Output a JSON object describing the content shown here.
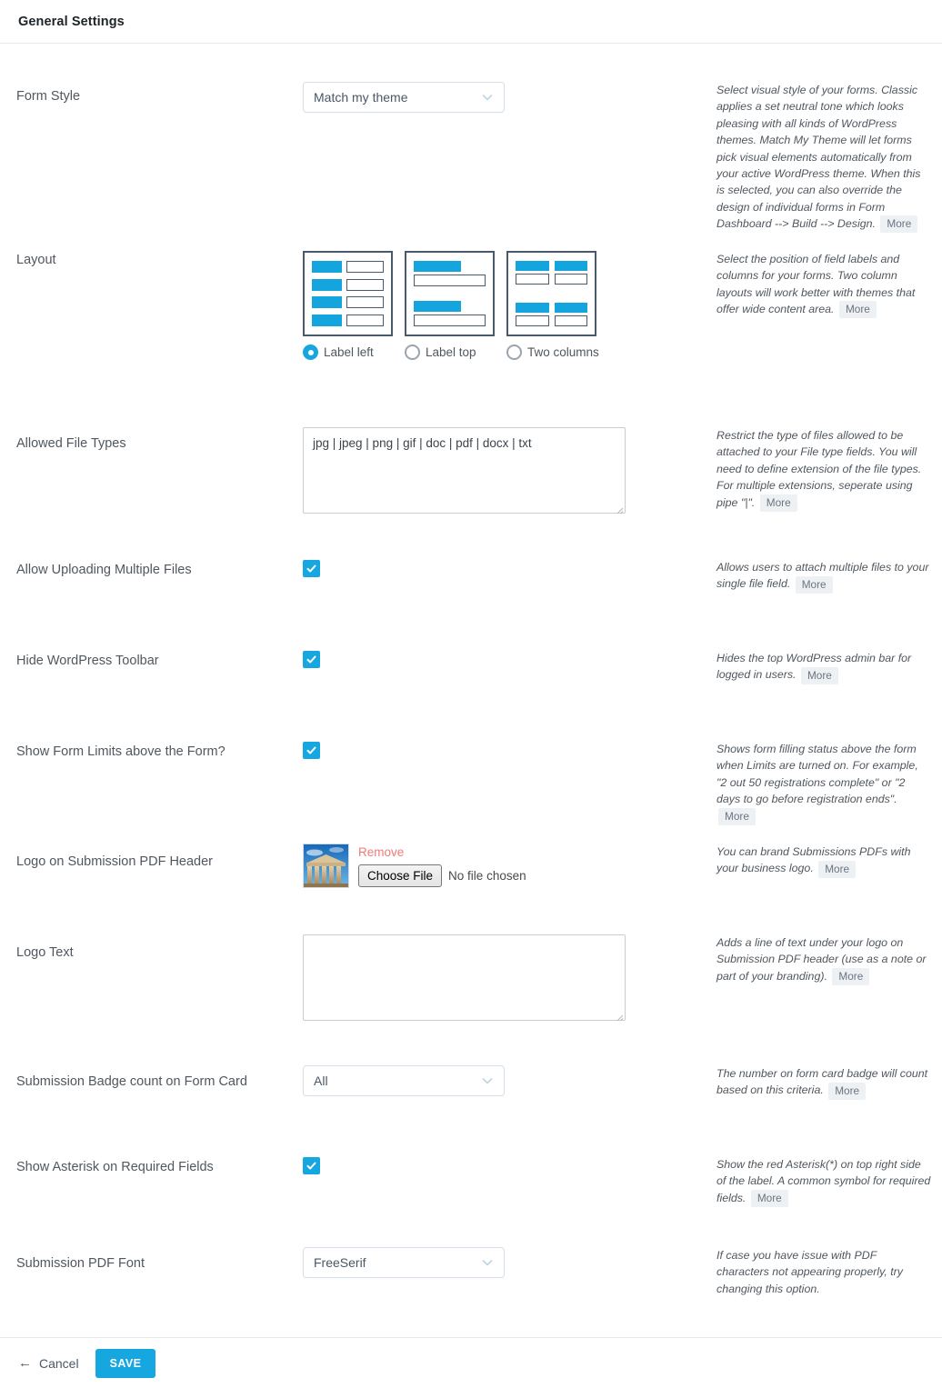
{
  "header": {
    "title": "General Settings"
  },
  "settings": {
    "form_style": {
      "label": "Form Style",
      "value": "Match my theme",
      "description": "Select visual style of your forms. Classic applies a set neutral tone which looks pleasing with all kinds of WordPress themes. Match My Theme will let forms pick visual elements automatically from your active WordPress theme. When this is selected, you can also override the design of individual forms in Form Dashboard --> Build --> Design.",
      "more_label": "More"
    },
    "layout": {
      "label": "Layout",
      "description": "Select the position of field labels and columns for your forms. Two column layouts will work better with themes that offer wide content area.",
      "more_label": "More",
      "options": [
        {
          "label": "Label left",
          "selected": true
        },
        {
          "label": "Label top",
          "selected": false
        },
        {
          "label": "Two columns",
          "selected": false
        }
      ]
    },
    "allowed_file_types": {
      "label": "Allowed File Types",
      "value": "jpg | jpeg | png | gif | doc | pdf | docx | txt",
      "description": "Restrict the type of files allowed to be attached to your File type fields. You will need to define extension of the file types. For multiple extensions, seperate using pipe \"|\".",
      "more_label": "More"
    },
    "allow_multiple_files": {
      "label": "Allow Uploading Multiple Files",
      "checked": true,
      "description": "Allows users to attach multiple files to your single file field.",
      "more_label": "More"
    },
    "hide_toolbar": {
      "label": "Hide WordPress Toolbar",
      "checked": true,
      "description": "Hides the top WordPress admin bar for logged in users.",
      "more_label": "More"
    },
    "show_form_limits": {
      "label": "Show Form Limits above the Form?",
      "checked": true,
      "description": "Shows form filling status above the form when Limits are turned on. For example, \"2 out 50 registrations complete\" or \"2 days to go before registration ends\".",
      "more_label": "More"
    },
    "logo_pdf_header": {
      "label": "Logo on Submission PDF Header",
      "remove_label": "Remove",
      "choose_file_label": "Choose File",
      "no_file_text": "No file chosen",
      "description": "You can brand Submissions PDFs with your business logo.",
      "more_label": "More"
    },
    "logo_text": {
      "label": "Logo Text",
      "value": "",
      "description": "Adds a line of text under your logo on Submission PDF header (use as a note or part of your branding).",
      "more_label": "More"
    },
    "submission_badge_count": {
      "label": "Submission Badge count on Form Card",
      "value": "All",
      "description": "The number on form card badge will count based on this criteria.",
      "more_label": "More"
    },
    "show_asterisk": {
      "label": "Show Asterisk on Required Fields",
      "checked": true,
      "description": "Show the red Asterisk(*) on top right side of the label. A common symbol for required fields.",
      "more_label": "More"
    },
    "submission_pdf_font": {
      "label": "Submission PDF Font",
      "value": "FreeSerif",
      "description": "If case you have issue with PDF characters not appearing properly, try changing this option."
    }
  },
  "footer": {
    "cancel_label": "Cancel",
    "save_label": "SAVE"
  },
  "colors": {
    "accent": "#16a7e0",
    "layout_blue": "#15a5de",
    "remove_red": "#f07a7a",
    "text": "#50575e"
  }
}
